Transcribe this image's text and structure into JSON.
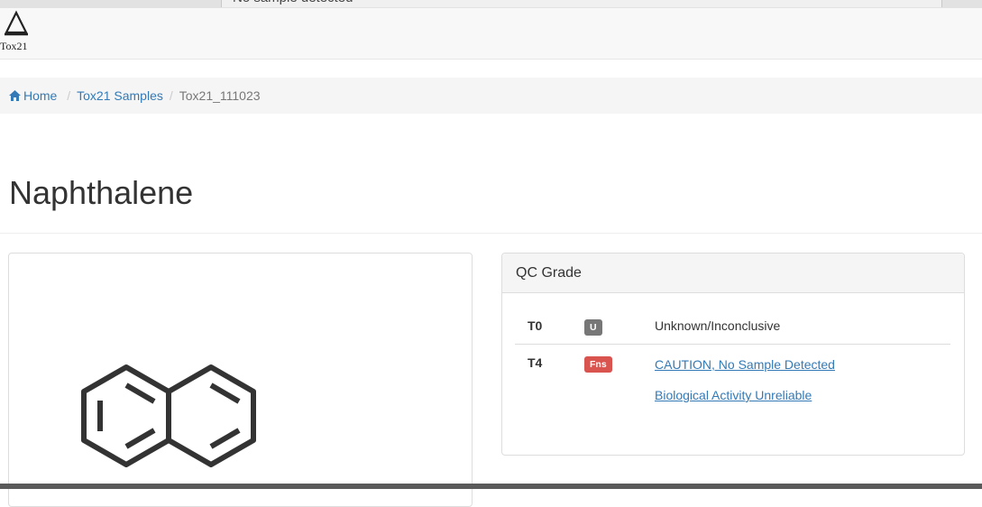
{
  "tooltip": {
    "text": "No sample detected"
  },
  "logo": {
    "text": "Tox21"
  },
  "breadcrumb": {
    "home": "Home",
    "samples": "Tox21 Samples",
    "current": "Tox21_111023"
  },
  "page": {
    "title": "Naphthalene"
  },
  "qc": {
    "heading": "QC Grade",
    "rows": [
      {
        "grade": "T0",
        "badge": "U",
        "badge_color": "#777777",
        "description": "Unknown/Inconclusive"
      },
      {
        "grade": "T4",
        "badge": "Fns",
        "badge_color": "#d9534f",
        "links": [
          "CAUTION, No Sample Detected",
          "Biological Activity Unreliable"
        ]
      }
    ]
  },
  "colors": {
    "link": "#337ab7",
    "badge_gray": "#777777",
    "badge_red": "#d9534f"
  }
}
